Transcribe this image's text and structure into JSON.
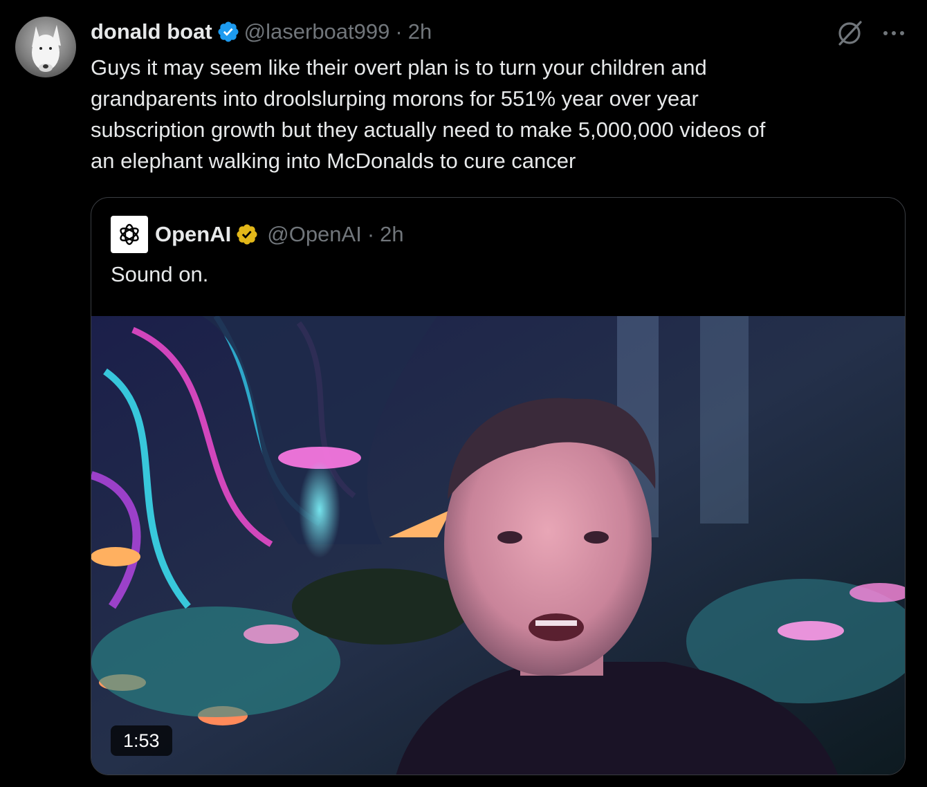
{
  "tweet": {
    "display_name": "donald boat",
    "handle": "@laserboat999",
    "separator": "·",
    "time": "2h",
    "text": "Guys it may seem like their overt plan is to turn your children and\ngrandparents into droolslurping morons for 551% year over year\nsubscription growth but they actually need to make 5,000,000 videos of\nan elephant walking into McDonalds to cure cancer",
    "verified_color": "#1d9bf0",
    "icons": [
      "grok-icon",
      "more-icon"
    ]
  },
  "quoted_tweet": {
    "display_name": "OpenAI",
    "handle": "@OpenAI",
    "separator": "·",
    "time": "2h",
    "text": "Sound on.",
    "verified_color": "#e2b719",
    "video": {
      "duration": "1:53"
    }
  },
  "colors": {
    "background": "#000000",
    "primary_text": "#e7e9ea",
    "secondary_text": "#71767b",
    "border": "#3a3d42"
  }
}
